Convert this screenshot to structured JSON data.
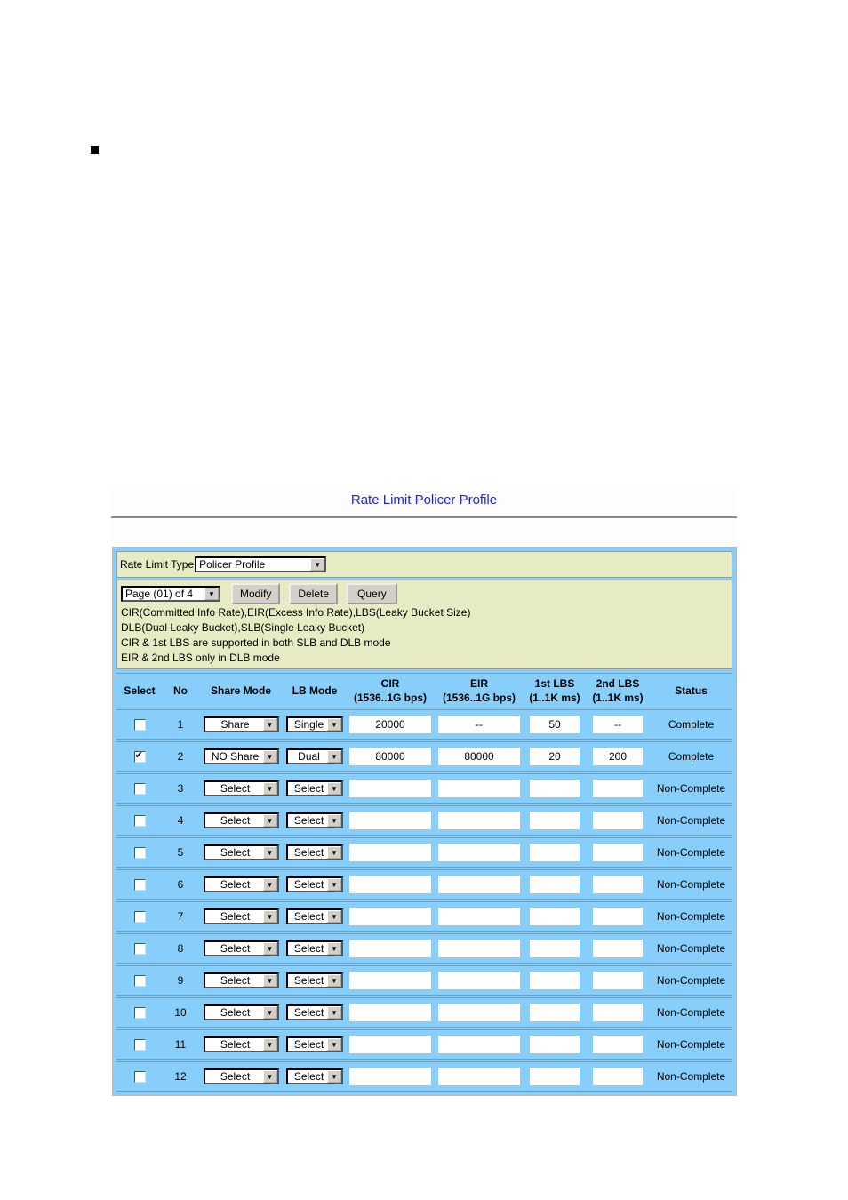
{
  "page": {
    "title": "Rate Limit Policer Profile"
  },
  "rate_limit_type": {
    "label": "Rate Limit Type",
    "value": "Policer Profile"
  },
  "toolbar": {
    "page_select": "Page (01) of 4",
    "modify_label": "Modify",
    "delete_label": "Delete",
    "query_label": "Query"
  },
  "notes": [
    "CIR(Committed Info Rate),EIR(Excess Info Rate),LBS(Leaky Bucket Size)",
    "DLB(Dual Leaky Bucket),SLB(Single Leaky Bucket)",
    "CIR & 1st LBS are supported in both SLB and DLB mode",
    "EIR & 2nd LBS only in DLB mode"
  ],
  "table": {
    "headers": {
      "select": "Select",
      "no": "No",
      "share_mode": "Share Mode",
      "lb_mode": "LB Mode",
      "cir": "CIR",
      "cir_sub": "(1536..1G bps)",
      "eir": "EIR",
      "eir_sub": "(1536..1G bps)",
      "lbs1": "1st LBS",
      "lbs1_sub": "(1..1K ms)",
      "lbs2": "2nd LBS",
      "lbs2_sub": "(1..1K ms)",
      "status": "Status"
    },
    "rows": [
      {
        "checked": false,
        "no": "1",
        "share": "Share",
        "lb": "Single",
        "cir": "20000",
        "eir": "--",
        "lbs1": "50",
        "lbs2": "--",
        "status": "Complete"
      },
      {
        "checked": true,
        "no": "2",
        "share": "NO Share",
        "lb": "Dual",
        "cir": "80000",
        "eir": "80000",
        "lbs1": "20",
        "lbs2": "200",
        "status": "Complete"
      },
      {
        "checked": false,
        "no": "3",
        "share": "Select",
        "lb": "Select",
        "cir": "",
        "eir": "",
        "lbs1": "",
        "lbs2": "",
        "status": "Non-Complete"
      },
      {
        "checked": false,
        "no": "4",
        "share": "Select",
        "lb": "Select",
        "cir": "",
        "eir": "",
        "lbs1": "",
        "lbs2": "",
        "status": "Non-Complete"
      },
      {
        "checked": false,
        "no": "5",
        "share": "Select",
        "lb": "Select",
        "cir": "",
        "eir": "",
        "lbs1": "",
        "lbs2": "",
        "status": "Non-Complete"
      },
      {
        "checked": false,
        "no": "6",
        "share": "Select",
        "lb": "Select",
        "cir": "",
        "eir": "",
        "lbs1": "",
        "lbs2": "",
        "status": "Non-Complete"
      },
      {
        "checked": false,
        "no": "7",
        "share": "Select",
        "lb": "Select",
        "cir": "",
        "eir": "",
        "lbs1": "",
        "lbs2": "",
        "status": "Non-Complete"
      },
      {
        "checked": false,
        "no": "8",
        "share": "Select",
        "lb": "Select",
        "cir": "",
        "eir": "",
        "lbs1": "",
        "lbs2": "",
        "status": "Non-Complete"
      },
      {
        "checked": false,
        "no": "9",
        "share": "Select",
        "lb": "Select",
        "cir": "",
        "eir": "",
        "lbs1": "",
        "lbs2": "",
        "status": "Non-Complete"
      },
      {
        "checked": false,
        "no": "10",
        "share": "Select",
        "lb": "Select",
        "cir": "",
        "eir": "",
        "lbs1": "",
        "lbs2": "",
        "status": "Non-Complete"
      },
      {
        "checked": false,
        "no": "11",
        "share": "Select",
        "lb": "Select",
        "cir": "",
        "eir": "",
        "lbs1": "",
        "lbs2": "",
        "status": "Non-Complete"
      },
      {
        "checked": false,
        "no": "12",
        "share": "Select",
        "lb": "Select",
        "cir": "",
        "eir": "",
        "lbs1": "",
        "lbs2": "",
        "status": "Non-Complete"
      }
    ]
  }
}
